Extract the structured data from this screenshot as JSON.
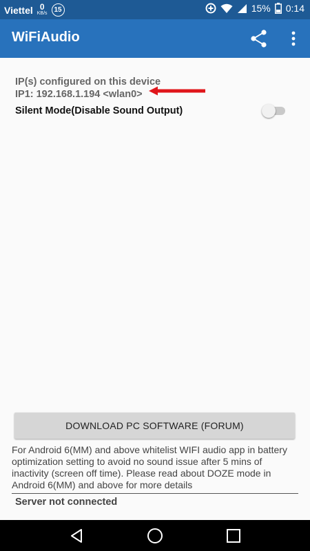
{
  "status_bar": {
    "carrier": "Viettel",
    "data_speed_value": "0",
    "data_speed_unit": "KB/s",
    "notification_count": "15",
    "battery": "15%",
    "time": "0:14"
  },
  "app_bar": {
    "title": "WiFiAudio"
  },
  "ip_info": {
    "heading": "IP(s) configured on this device",
    "ip1": "IP1: 192.168.1.194 <wlan0>"
  },
  "silent_mode": {
    "label": "Silent Mode(Disable Sound Output)",
    "enabled": false
  },
  "download_button": {
    "label": "DOWNLOAD PC SOFTWARE (FORUM)"
  },
  "note": "For Android 6(MM) and above whitelist WIFI audio app in battery optimization setting to avoid no sound issue after 5 mins of inactivity (screen off time). Please read about DOZE mode in Android 6(MM) and above for more details",
  "server_status": "Server not connected",
  "colors": {
    "status_bar": "#1e5a95",
    "app_bar": "#2872bc",
    "arrow": "#e0161b"
  }
}
